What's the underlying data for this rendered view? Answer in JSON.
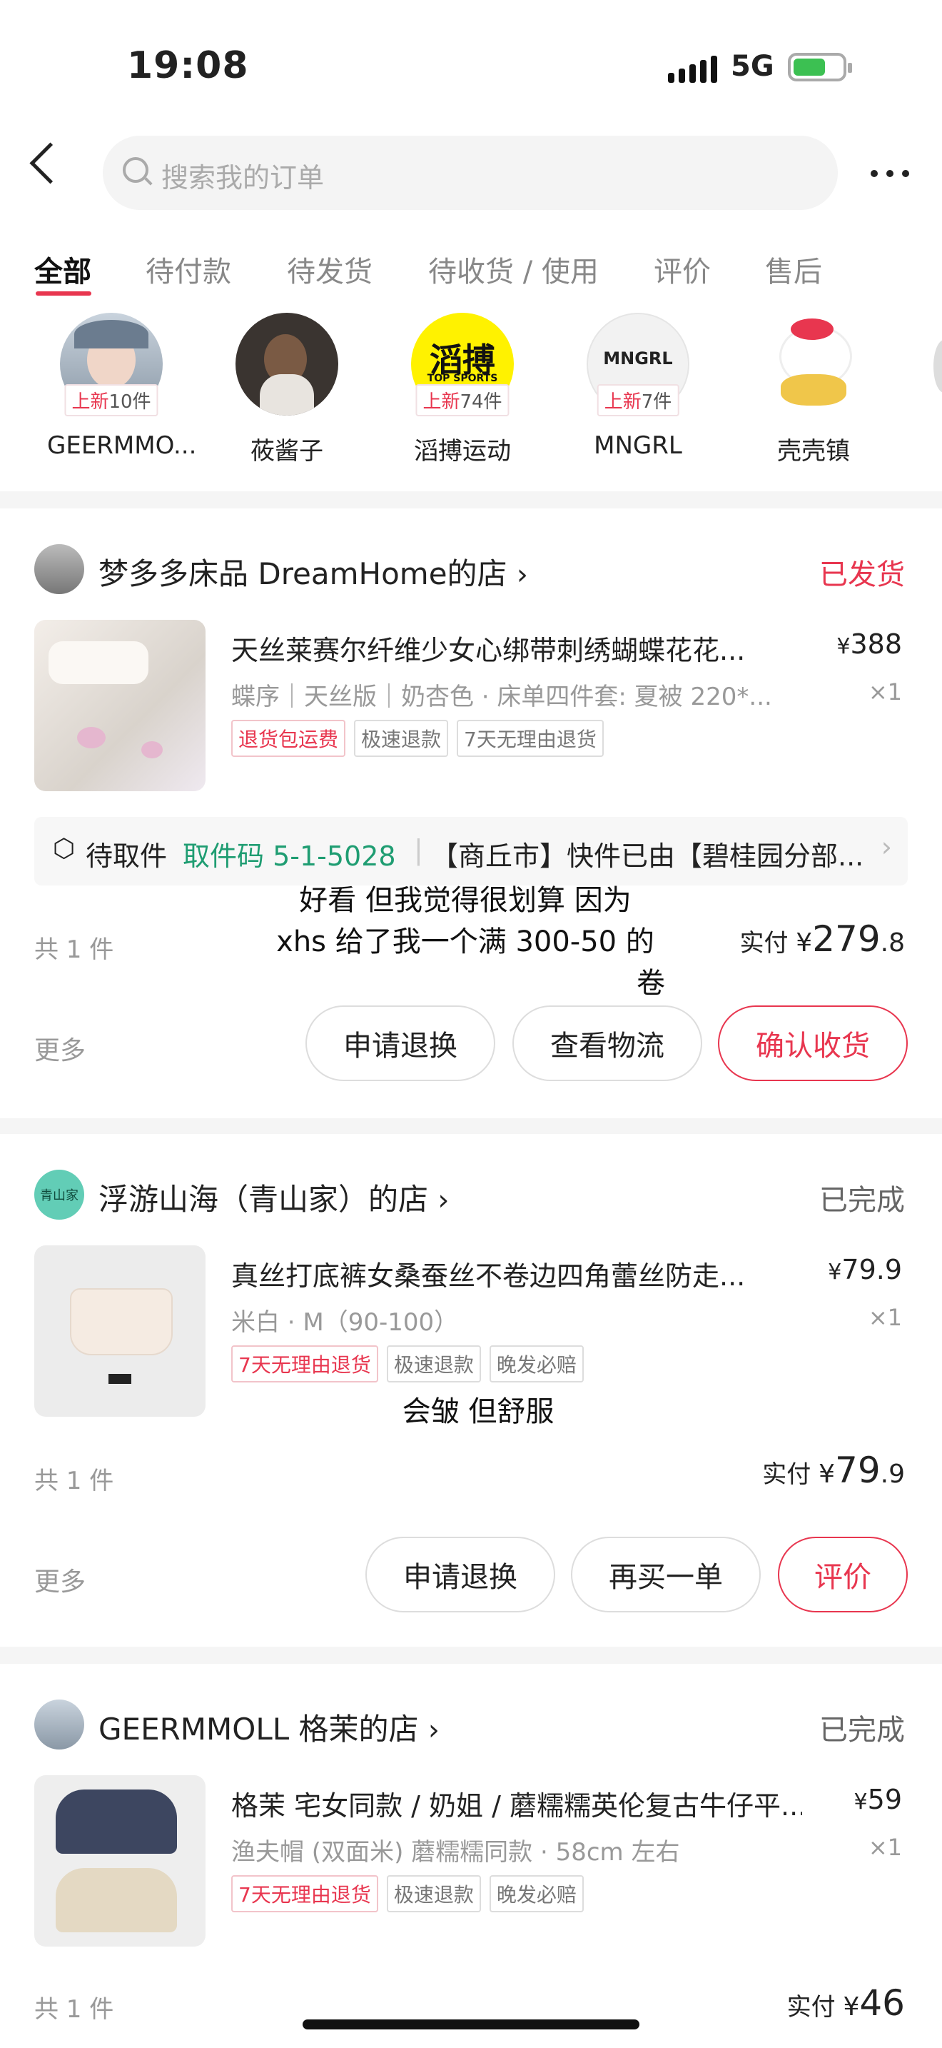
{
  "status_bar": {
    "time": "19:08",
    "network": "5G"
  },
  "search": {
    "placeholder": "搜索我的订单"
  },
  "tabs": [
    "全部",
    "待付款",
    "待发货",
    "待收货 / 使用",
    "评价",
    "售后"
  ],
  "shops": [
    {
      "name": "GEERMMO...",
      "badge_prefix": "上新",
      "badge_count": "10件"
    },
    {
      "name": "莜酱子"
    },
    {
      "name": "滔搏运动",
      "logo_text": "滔搏",
      "logo_sub": "TOP SPORTS",
      "badge_prefix": "上新",
      "badge_count": "74件"
    },
    {
      "name": "MNGRL",
      "logo_text": "MNGRL",
      "badge_prefix": "上新",
      "badge_count": "7件"
    },
    {
      "name": "壳壳镇"
    }
  ],
  "orders": [
    {
      "store": "梦多多床品 DreamHome的店",
      "status": "已发货",
      "status_color": "#e8364f",
      "product_title": "天丝莱赛尔纤维少女心绑带刺绣蝴蝶花花...",
      "price": "388",
      "spec": "蝶序｜天丝版｜奶杏色 · 床单四件套:  夏被 220*...",
      "qty": "×1",
      "tags": [
        "退货包运费",
        "极速退款",
        "7天无理由退货"
      ],
      "pickup": {
        "label": "待取件",
        "code": "取件码 5-1-5028",
        "message": "【商丘市】快件已由【碧桂园分部..."
      },
      "count": "共 1 件",
      "paid_label": "实付",
      "paid_int": "279",
      "paid_dec": ".8",
      "more": "更多",
      "buttons": [
        "申请退换",
        "查看物流",
        "确认收货"
      ],
      "annotation": [
        "好看 但我觉得很划算 因为",
        "xhs 给了我一个满 300-50 的",
        "卷"
      ]
    },
    {
      "store": "浮游山海（青山家）的店",
      "avatar_text": "青山家",
      "status": "已完成",
      "status_color": "#666666",
      "product_title": "真丝打底裤女桑蚕丝不卷边四角蕾丝防走...",
      "price": "79.9",
      "spec": "米白 · M（90-100）",
      "qty": "×1",
      "tags": [
        "7天无理由退货",
        "极速退款",
        "晚发必赔"
      ],
      "count": "共 1 件",
      "paid_label": "实付",
      "paid_int": "79",
      "paid_dec": ".9",
      "more": "更多",
      "buttons": [
        "申请退换",
        "再买一单",
        "评价"
      ],
      "annotation": [
        "会皱 但舒服"
      ]
    },
    {
      "store": "GEERMMOLL 格茉的店",
      "status": "已完成",
      "status_color": "#666666",
      "product_title": "格茉 宅女同款 / 奶姐 / 蘑糯糯英伦复古牛仔平...",
      "price": "59",
      "spec": "渔夫帽 (双面米) 蘑糯糯同款 · 58cm 左右",
      "qty": "×1",
      "tags": [
        "7天无理由退货",
        "极速退款",
        "晚发必赔"
      ],
      "count": "共 1 件",
      "paid_label": "实付",
      "paid_int": "46"
    }
  ],
  "colors": {
    "accent": "#e8364f",
    "green": "#1f9d72"
  }
}
